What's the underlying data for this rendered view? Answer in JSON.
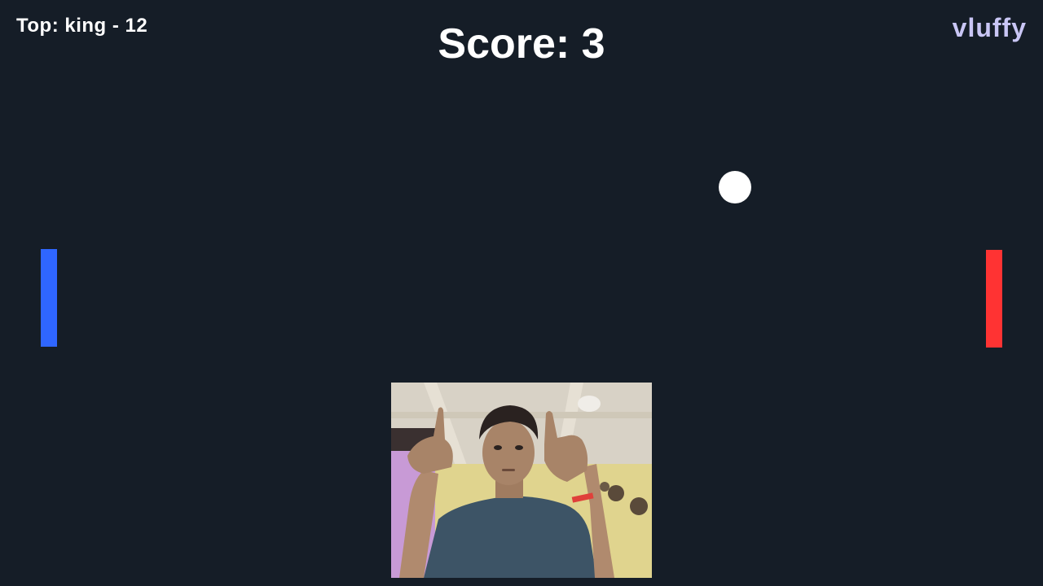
{
  "hud": {
    "top_score": "Top: king - 12",
    "score": "Score: 3",
    "player_name": "vluffy"
  },
  "colors": {
    "background": "#151d27",
    "left_paddle": "#2f66ff",
    "right_paddle": "#ff3333",
    "ball": "#ffffff",
    "player_name": "#c9c6f5"
  },
  "webcam": {
    "description_icon": "person-video-feed"
  }
}
